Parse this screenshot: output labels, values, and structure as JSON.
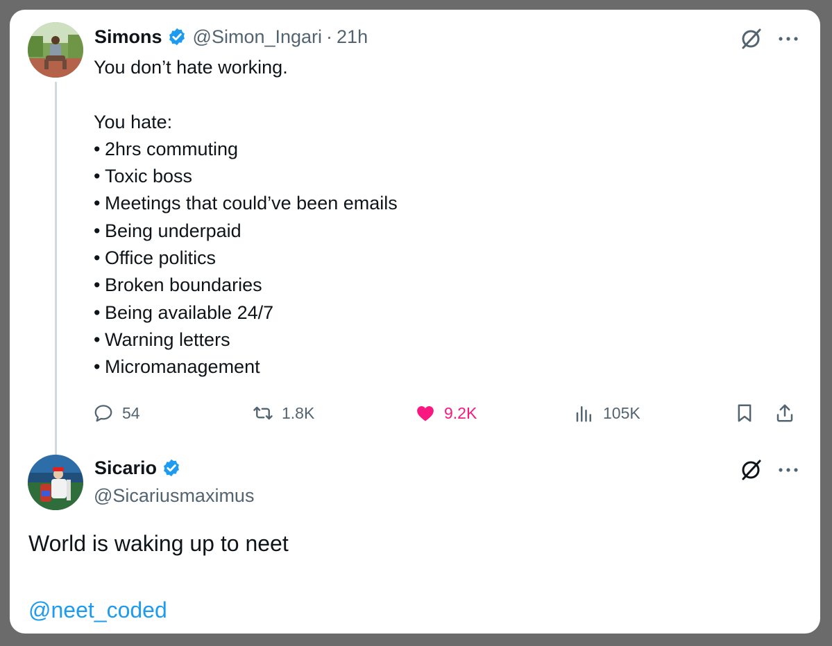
{
  "colors": {
    "text": "#0f1419",
    "muted": "#536471",
    "like": "#f91880",
    "link": "#1d9bf0",
    "verified": "#1d9bf0"
  },
  "tweet1": {
    "name": "Simons",
    "handle": "@Simon_Ingari",
    "separator": "·",
    "time": "21h",
    "text_intro": "You don’t hate working.",
    "text_lead": "You hate:",
    "bullet": "•",
    "items": [
      "2hrs commuting",
      "Toxic boss",
      "Meetings that could’ve been emails",
      "Being underpaid",
      "Office politics",
      "Broken boundaries",
      "Being available 24/7",
      "Warning letters",
      "Micromanagement"
    ],
    "stats": {
      "replies": "54",
      "reposts": "1.8K",
      "likes": "9.2K",
      "views": "105K"
    }
  },
  "tweet2": {
    "name": "Sicario",
    "handle": "@Sicariusmaximus",
    "text": "World is waking up to neet",
    "mention": "@neet_coded"
  }
}
